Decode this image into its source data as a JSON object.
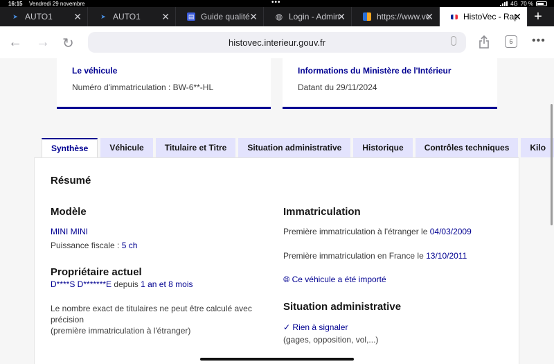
{
  "status": {
    "time": "16:15",
    "date": "Vendredi 29 novembre",
    "network": "4G",
    "battery": "70 %"
  },
  "browser_tabs": [
    {
      "label": "AUTO1",
      "icon": "auto1-favicon"
    },
    {
      "label": "AUTO1",
      "icon": "auto1-favicon"
    },
    {
      "label": "Guide qualité - C",
      "icon": "guide-favicon"
    },
    {
      "label": "Login - Admin C",
      "icon": "globe-icon"
    },
    {
      "label": "https://www.ven",
      "icon": "flag-favicon"
    },
    {
      "label": "HistoVec - Rapp",
      "icon": "french-flag-favicon",
      "active": true
    }
  ],
  "address_bar": {
    "url": "histovec.interieur.gouv.fr"
  },
  "tab_count": "6",
  "cards": {
    "vehicle": {
      "title": "Le véhicule",
      "value": "Numéro d'immatriculation : BW-6**-HL"
    },
    "ministry": {
      "title": "Informations du Ministère de l'Intérieur",
      "value": "Datant du 29/11/2024"
    }
  },
  "report_tabs": [
    "Synthèse",
    "Véhicule",
    "Titulaire et Titre",
    "Situation administrative",
    "Historique",
    "Contrôles techniques",
    "Kilo"
  ],
  "summary": {
    "heading": "Résumé",
    "model": {
      "heading": "Modèle",
      "name": "MINI MINI",
      "power_label": "Puissance fiscale :",
      "power_value": "5 ch"
    },
    "owner": {
      "heading": "Propriétaire actuel",
      "name": "D****S D*******E",
      "since_label": "depuis",
      "since_value": "1 an et 8 mois",
      "note_line1": "Le nombre exact de titulaires ne peut être calculé avec",
      "note_line2": "précision",
      "note_line3": "(première immatriculation à l'étranger)"
    },
    "registration": {
      "heading": "Immatriculation",
      "abroad_label": "Première immatriculation à l'étranger le",
      "abroad_date": "04/03/2009",
      "france_label": "Première immatriculation en France le",
      "france_date": "13/10/2011",
      "imported": "Ce véhicule a été importé"
    },
    "admin": {
      "heading": "Situation administrative",
      "status": "Rien à signaler",
      "detail": "(gages, opposition, vol,...)"
    }
  },
  "colors": {
    "accent": "#000091",
    "tab_bg": "#e3e3fd"
  }
}
